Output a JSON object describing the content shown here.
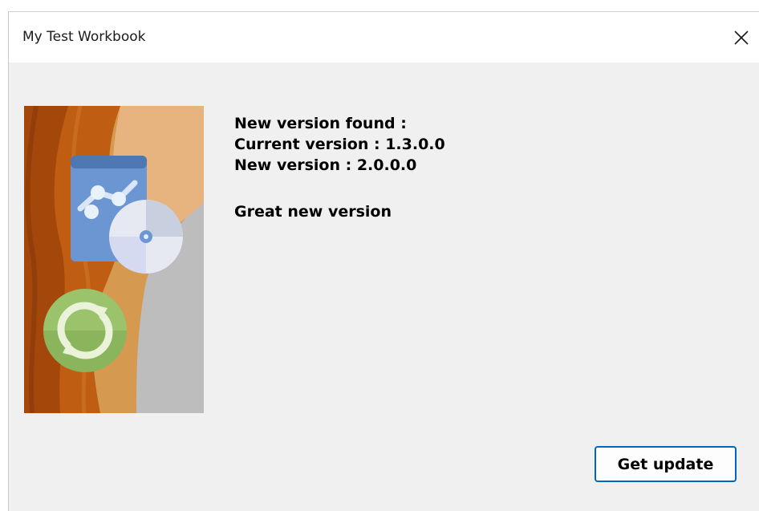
{
  "window": {
    "title": "My Test Workbook"
  },
  "message": {
    "line1": "New version found :",
    "line2": "Current version : 1.3.0.0",
    "line3": "New version : 2.0.0.0",
    "line4": "Great new version"
  },
  "actions": {
    "get_update_label": "Get update"
  },
  "icons": {
    "close": "close-icon",
    "banner": "update-banner-image"
  },
  "colors": {
    "button_border": "#0067c0",
    "dialog_bg": "#f0f0f0",
    "banner_orange": "#c55a11",
    "banner_green": "#9bc36b"
  }
}
